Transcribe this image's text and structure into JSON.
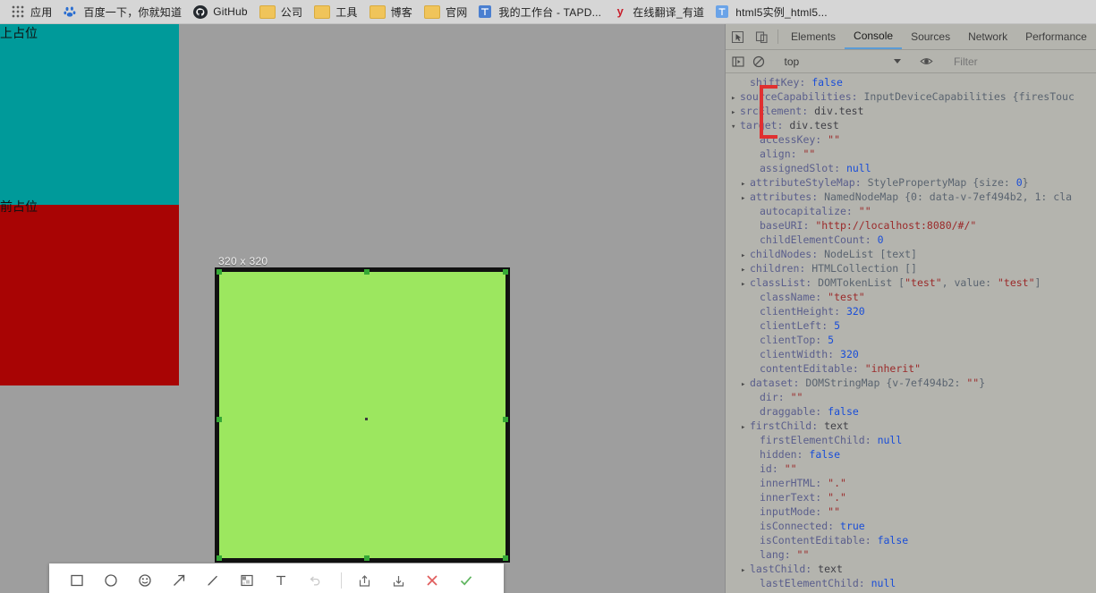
{
  "bookmarks_bar": {
    "items": [
      {
        "label": "应用",
        "icon": "apps-grid-icon",
        "icon_kind": "apps"
      },
      {
        "label": "百度一下，你就知道",
        "icon": "baidu-icon",
        "icon_kind": "baidu"
      },
      {
        "label": "GitHub",
        "icon": "github-icon",
        "icon_kind": "github"
      },
      {
        "label": "公司",
        "icon": "folder-icon",
        "icon_kind": "folder"
      },
      {
        "label": "工具",
        "icon": "folder-icon",
        "icon_kind": "folder"
      },
      {
        "label": "博客",
        "icon": "folder-icon",
        "icon_kind": "folder"
      },
      {
        "label": "官网",
        "icon": "folder-icon",
        "icon_kind": "folder"
      },
      {
        "label": "我的工作台 - TAPD...",
        "icon": "tapd-icon",
        "icon_kind": "tapd"
      },
      {
        "label": "在线翻译_有道",
        "icon": "youdao-icon",
        "icon_kind": "youdao"
      },
      {
        "label": "html5实例_html5...",
        "icon": "html5-icon",
        "icon_kind": "html5"
      }
    ]
  },
  "page": {
    "blocks": [
      {
        "label": "上占位",
        "color": "#009a9a"
      },
      {
        "label": "前占位",
        "color": "#a80404"
      }
    ]
  },
  "screenshot": {
    "size_label": "320 x 320",
    "selection_fill": "#9ce75f",
    "selection_border": "#111111",
    "handle_color": "#36a836",
    "toolbar": [
      {
        "name": "rectangle-tool",
        "title": "矩形"
      },
      {
        "name": "ellipse-tool",
        "title": "椭圆"
      },
      {
        "name": "emoji-tool",
        "title": "表情"
      },
      {
        "name": "arrow-tool",
        "title": "箭头"
      },
      {
        "name": "pen-tool",
        "title": "画笔"
      },
      {
        "name": "mosaic-tool",
        "title": "马赛克"
      },
      {
        "name": "text-tool",
        "title": "文字"
      },
      {
        "name": "undo-tool",
        "title": "撤销"
      },
      {
        "name": "separator",
        "title": ""
      },
      {
        "name": "share-tool",
        "title": "分享"
      },
      {
        "name": "download-tool",
        "title": "下载"
      },
      {
        "name": "close-tool",
        "title": "取消"
      },
      {
        "name": "confirm-tool",
        "title": "确定"
      }
    ],
    "close_color": "#e05c5c",
    "confirm_color": "#5fb55f"
  },
  "devtools": {
    "tabs": [
      {
        "label": "Elements",
        "active": false
      },
      {
        "label": "Console",
        "active": true
      },
      {
        "label": "Sources",
        "active": false
      },
      {
        "label": "Network",
        "active": false
      },
      {
        "label": "Performance",
        "active": false
      }
    ],
    "context": "top",
    "filter_placeholder": "Filter",
    "annotation_color": "#e03030",
    "console_lines": [
      {
        "tri": "",
        "indent": 1,
        "parts": [
          {
            "t": "shiftKey: ",
            "c": "prop"
          },
          {
            "t": "false",
            "c": "val-kw"
          }
        ]
      },
      {
        "tri": "▸",
        "indent": 0,
        "parts": [
          {
            "t": "sourceCapabilities: ",
            "c": "prop"
          },
          {
            "t": "InputDeviceCapabilities {firesTouc",
            "c": "val-obj"
          }
        ]
      },
      {
        "tri": "▸",
        "indent": 0,
        "parts": [
          {
            "t": "srcElement: ",
            "c": "prop"
          },
          {
            "t": "div.test",
            "c": "val-plain"
          }
        ]
      },
      {
        "tri": "▾",
        "indent": 0,
        "parts": [
          {
            "t": "target: ",
            "c": "prop"
          },
          {
            "t": "div.test",
            "c": "val-plain"
          }
        ]
      },
      {
        "tri": "",
        "indent": 2,
        "parts": [
          {
            "t": "accessKey: ",
            "c": "prop"
          },
          {
            "t": "\"\"",
            "c": "val-str"
          }
        ]
      },
      {
        "tri": "",
        "indent": 2,
        "parts": [
          {
            "t": "align: ",
            "c": "prop"
          },
          {
            "t": "\"\"",
            "c": "val-str"
          }
        ]
      },
      {
        "tri": "",
        "indent": 2,
        "parts": [
          {
            "t": "assignedSlot: ",
            "c": "prop"
          },
          {
            "t": "null",
            "c": "val-kw"
          }
        ]
      },
      {
        "tri": "▸",
        "indent": 1,
        "parts": [
          {
            "t": "attributeStyleMap: ",
            "c": "prop"
          },
          {
            "t": "StylePropertyMap {size: ",
            "c": "val-obj"
          },
          {
            "t": "0",
            "c": "val-num"
          },
          {
            "t": "}",
            "c": "val-obj"
          }
        ]
      },
      {
        "tri": "▸",
        "indent": 1,
        "parts": [
          {
            "t": "attributes: ",
            "c": "prop"
          },
          {
            "t": "NamedNodeMap {0: data-v-7ef494b2, 1: cla",
            "c": "val-obj"
          }
        ]
      },
      {
        "tri": "",
        "indent": 2,
        "parts": [
          {
            "t": "autocapitalize: ",
            "c": "prop"
          },
          {
            "t": "\"\"",
            "c": "val-str"
          }
        ]
      },
      {
        "tri": "",
        "indent": 2,
        "parts": [
          {
            "t": "baseURI: ",
            "c": "prop"
          },
          {
            "t": "\"http://localhost:8080/#/\"",
            "c": "val-str"
          }
        ]
      },
      {
        "tri": "",
        "indent": 2,
        "parts": [
          {
            "t": "childElementCount: ",
            "c": "prop"
          },
          {
            "t": "0",
            "c": "val-num"
          }
        ]
      },
      {
        "tri": "▸",
        "indent": 1,
        "parts": [
          {
            "t": "childNodes: ",
            "c": "prop"
          },
          {
            "t": "NodeList [text]",
            "c": "val-obj"
          }
        ]
      },
      {
        "tri": "▸",
        "indent": 1,
        "parts": [
          {
            "t": "children: ",
            "c": "prop"
          },
          {
            "t": "HTMLCollection []",
            "c": "val-obj"
          }
        ]
      },
      {
        "tri": "▸",
        "indent": 1,
        "parts": [
          {
            "t": "classList: ",
            "c": "prop"
          },
          {
            "t": "DOMTokenList [",
            "c": "val-obj"
          },
          {
            "t": "\"test\"",
            "c": "val-str"
          },
          {
            "t": ", value: ",
            "c": "val-obj"
          },
          {
            "t": "\"test\"",
            "c": "val-str"
          },
          {
            "t": "]",
            "c": "val-obj"
          }
        ]
      },
      {
        "tri": "",
        "indent": 2,
        "parts": [
          {
            "t": "className: ",
            "c": "prop"
          },
          {
            "t": "\"test\"",
            "c": "val-str"
          }
        ]
      },
      {
        "tri": "",
        "indent": 2,
        "parts": [
          {
            "t": "clientHeight: ",
            "c": "prop"
          },
          {
            "t": "320",
            "c": "val-num"
          }
        ]
      },
      {
        "tri": "",
        "indent": 2,
        "parts": [
          {
            "t": "clientLeft: ",
            "c": "prop"
          },
          {
            "t": "5",
            "c": "val-num"
          }
        ]
      },
      {
        "tri": "",
        "indent": 2,
        "parts": [
          {
            "t": "clientTop: ",
            "c": "prop"
          },
          {
            "t": "5",
            "c": "val-num"
          }
        ]
      },
      {
        "tri": "",
        "indent": 2,
        "parts": [
          {
            "t": "clientWidth: ",
            "c": "prop"
          },
          {
            "t": "320",
            "c": "val-num"
          }
        ]
      },
      {
        "tri": "",
        "indent": 2,
        "parts": [
          {
            "t": "contentEditable: ",
            "c": "prop"
          },
          {
            "t": "\"inherit\"",
            "c": "val-str"
          }
        ]
      },
      {
        "tri": "▸",
        "indent": 1,
        "parts": [
          {
            "t": "dataset: ",
            "c": "prop"
          },
          {
            "t": "DOMStringMap {v-7ef494b2: ",
            "c": "val-obj"
          },
          {
            "t": "\"\"",
            "c": "val-str"
          },
          {
            "t": "}",
            "c": "val-obj"
          }
        ]
      },
      {
        "tri": "",
        "indent": 2,
        "parts": [
          {
            "t": "dir: ",
            "c": "prop"
          },
          {
            "t": "\"\"",
            "c": "val-str"
          }
        ]
      },
      {
        "tri": "",
        "indent": 2,
        "parts": [
          {
            "t": "draggable: ",
            "c": "prop"
          },
          {
            "t": "false",
            "c": "val-kw"
          }
        ]
      },
      {
        "tri": "▸",
        "indent": 1,
        "parts": [
          {
            "t": "firstChild: ",
            "c": "prop"
          },
          {
            "t": "text",
            "c": "val-plain"
          }
        ]
      },
      {
        "tri": "",
        "indent": 2,
        "parts": [
          {
            "t": "firstElementChild: ",
            "c": "prop"
          },
          {
            "t": "null",
            "c": "val-kw"
          }
        ]
      },
      {
        "tri": "",
        "indent": 2,
        "parts": [
          {
            "t": "hidden: ",
            "c": "prop"
          },
          {
            "t": "false",
            "c": "val-kw"
          }
        ]
      },
      {
        "tri": "",
        "indent": 2,
        "parts": [
          {
            "t": "id: ",
            "c": "prop"
          },
          {
            "t": "\"\"",
            "c": "val-str"
          }
        ]
      },
      {
        "tri": "",
        "indent": 2,
        "parts": [
          {
            "t": "innerHTML: ",
            "c": "prop"
          },
          {
            "t": "\".\"",
            "c": "val-str"
          }
        ]
      },
      {
        "tri": "",
        "indent": 2,
        "parts": [
          {
            "t": "innerText: ",
            "c": "prop"
          },
          {
            "t": "\".\"",
            "c": "val-str"
          }
        ]
      },
      {
        "tri": "",
        "indent": 2,
        "parts": [
          {
            "t": "inputMode: ",
            "c": "prop"
          },
          {
            "t": "\"\"",
            "c": "val-str"
          }
        ]
      },
      {
        "tri": "",
        "indent": 2,
        "parts": [
          {
            "t": "isConnected: ",
            "c": "prop"
          },
          {
            "t": "true",
            "c": "val-kw"
          }
        ]
      },
      {
        "tri": "",
        "indent": 2,
        "parts": [
          {
            "t": "isContentEditable: ",
            "c": "prop"
          },
          {
            "t": "false",
            "c": "val-kw"
          }
        ]
      },
      {
        "tri": "",
        "indent": 2,
        "parts": [
          {
            "t": "lang: ",
            "c": "prop"
          },
          {
            "t": "\"\"",
            "c": "val-str"
          }
        ]
      },
      {
        "tri": "▸",
        "indent": 1,
        "parts": [
          {
            "t": "lastChild: ",
            "c": "prop"
          },
          {
            "t": "text",
            "c": "val-plain"
          }
        ]
      },
      {
        "tri": "",
        "indent": 2,
        "parts": [
          {
            "t": "lastElementChild: ",
            "c": "prop"
          },
          {
            "t": "null",
            "c": "val-kw"
          }
        ]
      }
    ]
  }
}
